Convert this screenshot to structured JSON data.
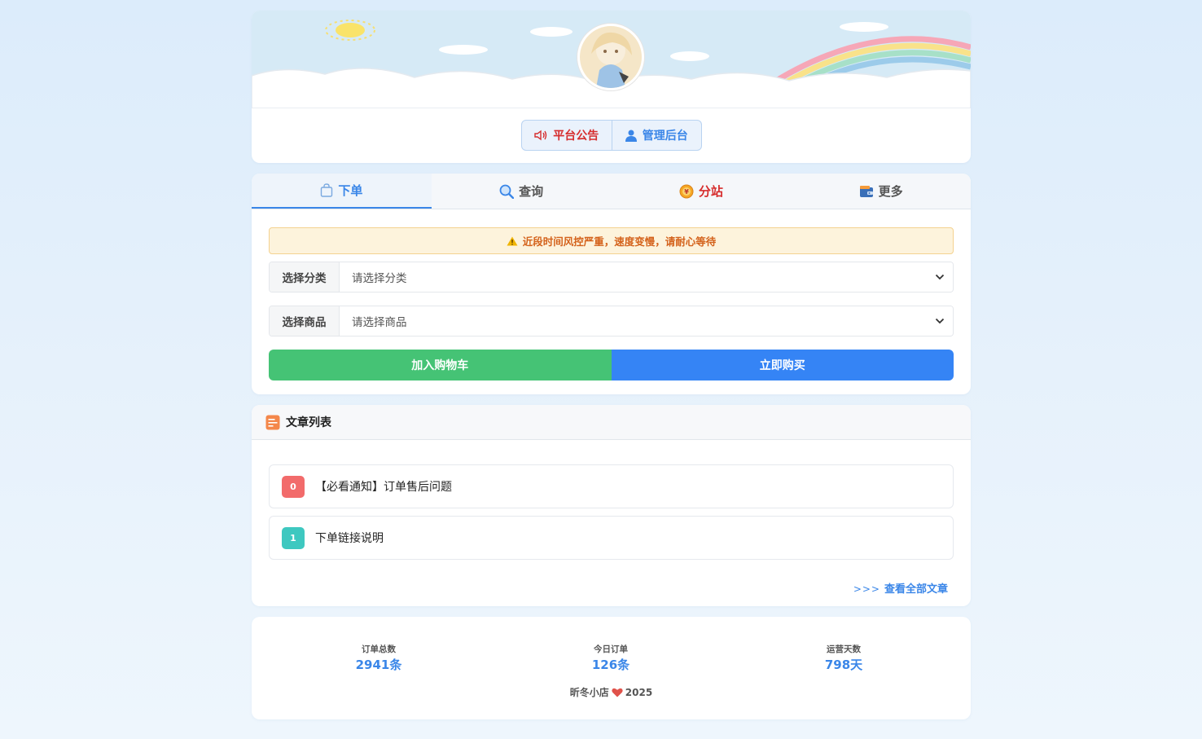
{
  "header": {
    "notice_button": "平台公告",
    "admin_button": "管理后台"
  },
  "tabs": [
    {
      "label": "下单",
      "icon": "shopping-bag-icon"
    },
    {
      "label": "查询",
      "icon": "search-icon"
    },
    {
      "label": "分站",
      "icon": "coin-icon"
    },
    {
      "label": "更多",
      "icon": "wallet-icon"
    }
  ],
  "order": {
    "alert": "近段时间风控严重，速度变慢，请耐心等待",
    "category_label": "选择分类",
    "category_placeholder": "请选择分类",
    "product_label": "选择商品",
    "product_placeholder": "请选择商品",
    "add_cart_button": "加入购物车",
    "buy_button": "立即购买"
  },
  "articles": {
    "title": "文章列表",
    "items": [
      {
        "index": "0",
        "title": "【必看通知】订单售后问题"
      },
      {
        "index": "1",
        "title": "下单链接说明"
      }
    ],
    "more_arrows": ">>>",
    "more_label": "查看全部文章"
  },
  "stats": {
    "total_orders_label": "订单总数",
    "total_orders_value": "2941条",
    "today_orders_label": "今日订单",
    "today_orders_value": "126条",
    "days_label": "运营天数",
    "days_value": "798天"
  },
  "footer": {
    "shop_name": "昕冬小店",
    "year": "2025"
  },
  "colors": {
    "primary": "#3a86e8",
    "danger": "#d62d2d",
    "cart_green": "#45c375",
    "buy_blue": "#3584f5",
    "alert_text": "#d4621b"
  }
}
